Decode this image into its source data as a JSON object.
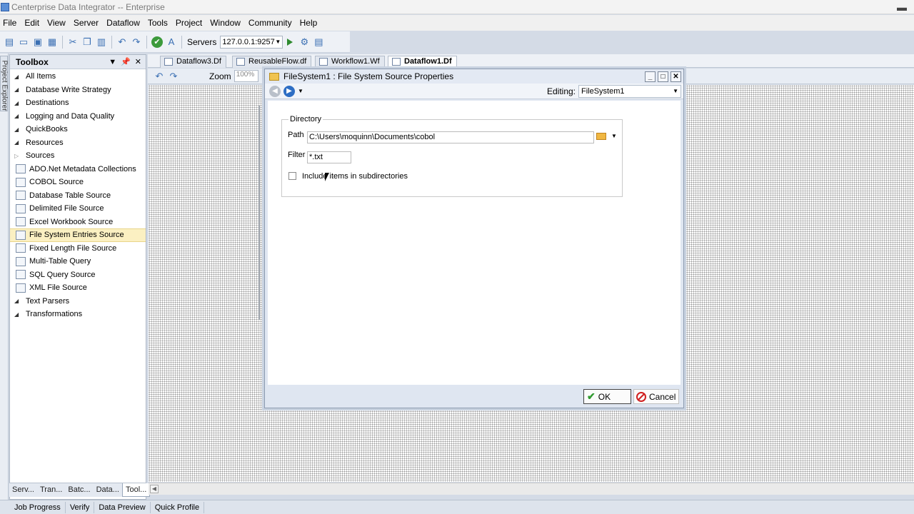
{
  "window": {
    "title": "Centerprise Data Integrator -- Enterprise"
  },
  "menu": [
    "File",
    "Edit",
    "View",
    "Server",
    "Dataflow",
    "Tools",
    "Project",
    "Window",
    "Community",
    "Help"
  ],
  "toolbar": {
    "servers_label": "Servers",
    "server_value": "127.0.0.1:9257"
  },
  "rail": {
    "label": "Project Explorer"
  },
  "toolbox": {
    "title": "Toolbox",
    "items": [
      {
        "label": "All Items",
        "kind": "category"
      },
      {
        "label": "Database Write Strategy",
        "kind": "category"
      },
      {
        "label": "Destinations",
        "kind": "category"
      },
      {
        "label": "Logging and Data Quality",
        "kind": "category"
      },
      {
        "label": "QuickBooks",
        "kind": "category"
      },
      {
        "label": "Resources",
        "kind": "category"
      },
      {
        "label": "Sources",
        "kind": "category-open"
      },
      {
        "label": "ADO.Net Metadata Collections",
        "kind": "item",
        "icon": "ado-icon"
      },
      {
        "label": "COBOL Source",
        "kind": "item",
        "icon": "cobol-icon"
      },
      {
        "label": "Database Table Source",
        "kind": "item",
        "icon": "database-table-icon"
      },
      {
        "label": "Delimited File Source",
        "kind": "item",
        "icon": "delimited-file-icon"
      },
      {
        "label": "Excel Workbook Source",
        "kind": "item",
        "icon": "excel-icon"
      },
      {
        "label": "File System Entries Source",
        "kind": "item",
        "icon": "folder-icon",
        "selected": true
      },
      {
        "label": "Fixed Length File Source",
        "kind": "item",
        "icon": "fixed-length-icon"
      },
      {
        "label": "Multi-Table Query",
        "kind": "item",
        "icon": "multi-table-icon"
      },
      {
        "label": "SQL Query Source",
        "kind": "item",
        "icon": "sql-icon"
      },
      {
        "label": "XML File Source",
        "kind": "item",
        "icon": "xml-icon"
      },
      {
        "label": "Text Parsers",
        "kind": "category"
      },
      {
        "label": "Transformations",
        "kind": "category"
      }
    ],
    "panel_tabs": [
      "Serv...",
      "Tran...",
      "Batc...",
      "Data...",
      "Tool..."
    ]
  },
  "doc_tabs": [
    "Dataflow3.Df",
    "ReusableFlow.df",
    "Workflow1.Wf",
    "Dataflow1.Df"
  ],
  "zoom": {
    "label": "Zoom",
    "value": "100%"
  },
  "status_tabs": [
    "Job Progress",
    "Verify",
    "Data Preview",
    "Quick Profile"
  ],
  "dialog": {
    "title": "FileSystem1 : File System Source Properties",
    "editing_label": "Editing:",
    "editing_value": "FileSystem1",
    "group_title": "Directory",
    "path_label": "Path",
    "path_value": "C:\\Users\\moquinn\\Documents\\cobol",
    "filter_label": "Filter",
    "filter_value": "*.txt",
    "include_label": "Include items in subdirectories",
    "include_checked": false,
    "ok_label": "OK",
    "cancel_label": "Cancel"
  }
}
